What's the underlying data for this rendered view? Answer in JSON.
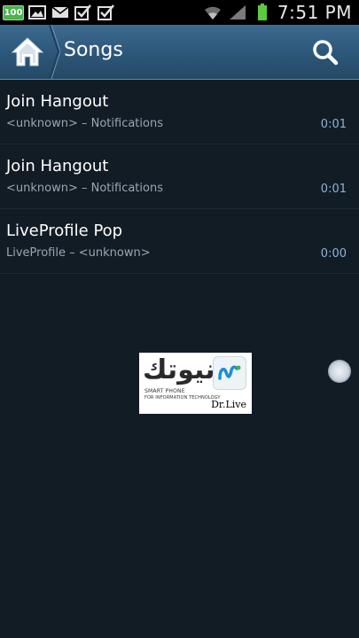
{
  "status_bar": {
    "battery_badge": "100",
    "time": "7:51 PM"
  },
  "action_bar": {
    "title": "Songs"
  },
  "songs": [
    {
      "title": "Join Hangout",
      "subtitle": "<unknown> – Notifications",
      "duration": "0:01"
    },
    {
      "title": "Join Hangout",
      "subtitle": "<unknown> – Notifications",
      "duration": "0:01"
    },
    {
      "title": "LiveProfile Pop",
      "subtitle": "LiveProfile – <unknown>",
      "duration": "0:00"
    }
  ],
  "watermark": {
    "arabic_text": "نيوتك",
    "line1": "SMART PHONE",
    "line2": "FOR INFORMATION TECHNOLOGY",
    "credit": "Dr.Live"
  },
  "colors": {
    "background": "#121c25",
    "action_bar": "#2c5678",
    "accent_duration": "#8fb3d6"
  }
}
